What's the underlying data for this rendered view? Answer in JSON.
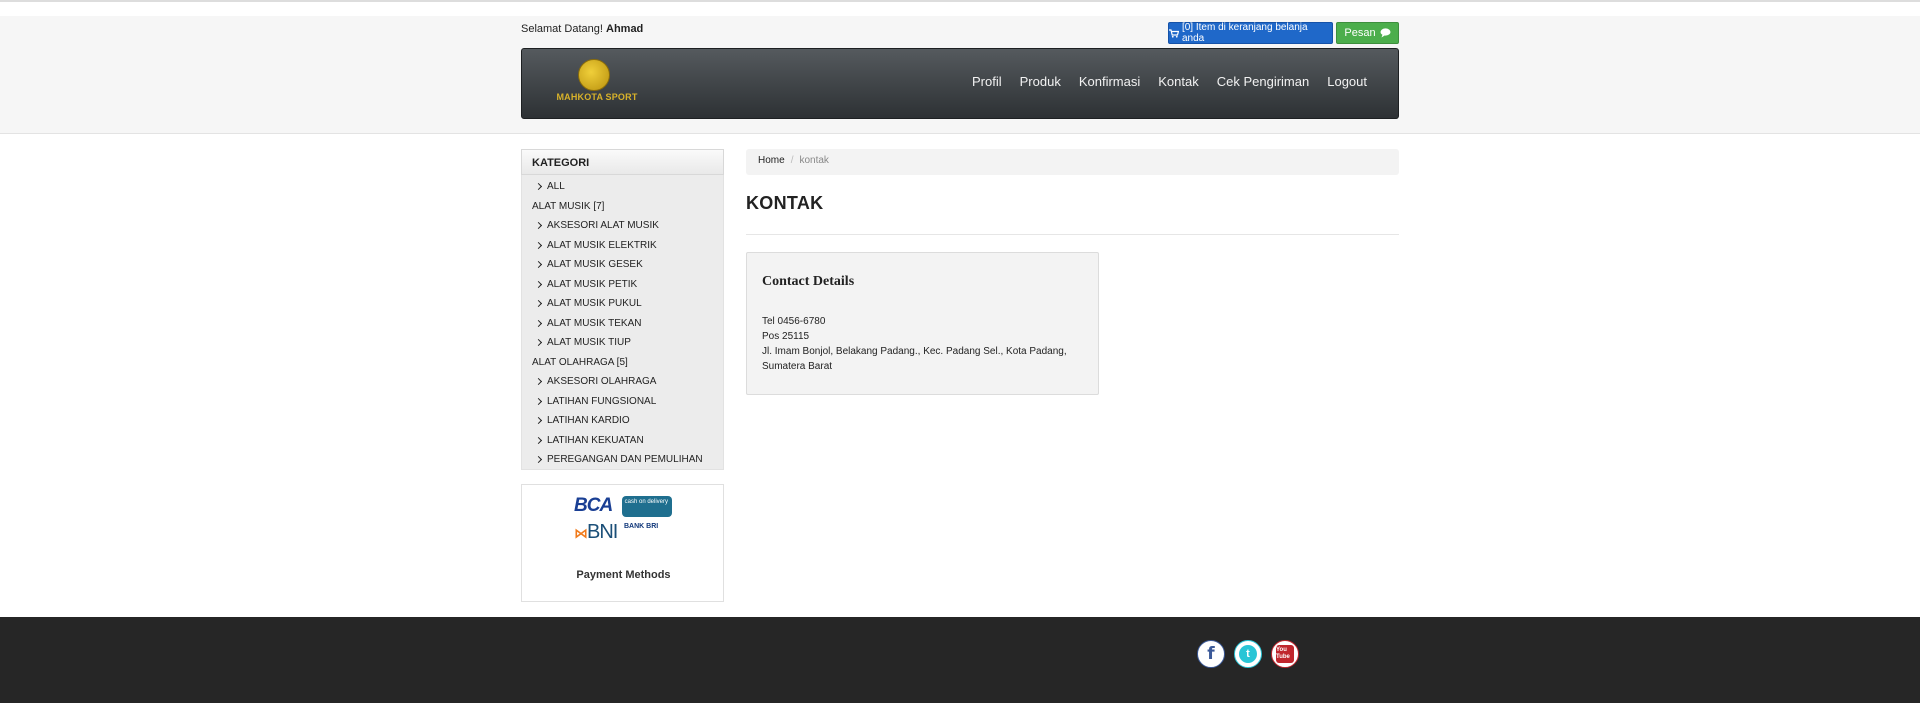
{
  "header": {
    "welcome_prefix": "Selamat Datang!",
    "user_name": "Ahmad",
    "cart_label": "[0] Item di keranjang belanja anda",
    "pesan_label": "Pesan",
    "logo_text": "MAHKOTA SPORT"
  },
  "nav": {
    "items": [
      "Profil",
      "Produk",
      "Konfirmasi",
      "Kontak",
      "Cek Pengiriman",
      "Logout"
    ]
  },
  "sidebar": {
    "title": "KATEGORI",
    "items": [
      {
        "label": "ALL",
        "kind": "sub"
      },
      {
        "label": "ALAT MUSIK [7]",
        "kind": "group"
      },
      {
        "label": "AKSESORI ALAT MUSIK",
        "kind": "sub"
      },
      {
        "label": "ALAT MUSIK ELEKTRIK",
        "kind": "sub"
      },
      {
        "label": "ALAT MUSIK GESEK",
        "kind": "sub"
      },
      {
        "label": "ALAT MUSIK PETIK",
        "kind": "sub"
      },
      {
        "label": "ALAT MUSIK PUKUL",
        "kind": "sub"
      },
      {
        "label": "ALAT MUSIK TEKAN",
        "kind": "sub"
      },
      {
        "label": "ALAT MUSIK TIUP",
        "kind": "sub"
      },
      {
        "label": "ALAT OLAHRAGA [5]",
        "kind": "group"
      },
      {
        "label": "AKSESORI OLAHRAGA",
        "kind": "sub"
      },
      {
        "label": "LATIHAN FUNGSIONAL",
        "kind": "sub"
      },
      {
        "label": "LATIHAN KARDIO",
        "kind": "sub"
      },
      {
        "label": "LATIHAN KEKUATAN",
        "kind": "sub"
      },
      {
        "label": "PEREGANGAN DAN PEMULIHAN",
        "kind": "sub"
      }
    ],
    "payment": {
      "label": "Payment Methods",
      "bca": "BCA",
      "cod": "cash on delivery",
      "bni": "BNI",
      "bri": "BANK BRI"
    }
  },
  "breadcrumb": {
    "home": "Home",
    "sep": "/",
    "current": "kontak"
  },
  "main": {
    "title": "KONTAK",
    "contact_title": "Contact Details",
    "lines": [
      "Tel 0456-6780",
      "Pos 25115",
      "Jl. Imam Bonjol, Belakang Padang., Kec. Padang Sel., Kota Padang, Sumatera Barat"
    ]
  },
  "footer": {
    "social": [
      "facebook-icon",
      "twitter-icon",
      "youtube-icon"
    ],
    "youtube_text": "You Tube"
  },
  "colors": {
    "navbar": "#2d3134",
    "cart_button": "#1f68c9",
    "pesan_button": "#4cae4c",
    "footer": "#262626"
  }
}
